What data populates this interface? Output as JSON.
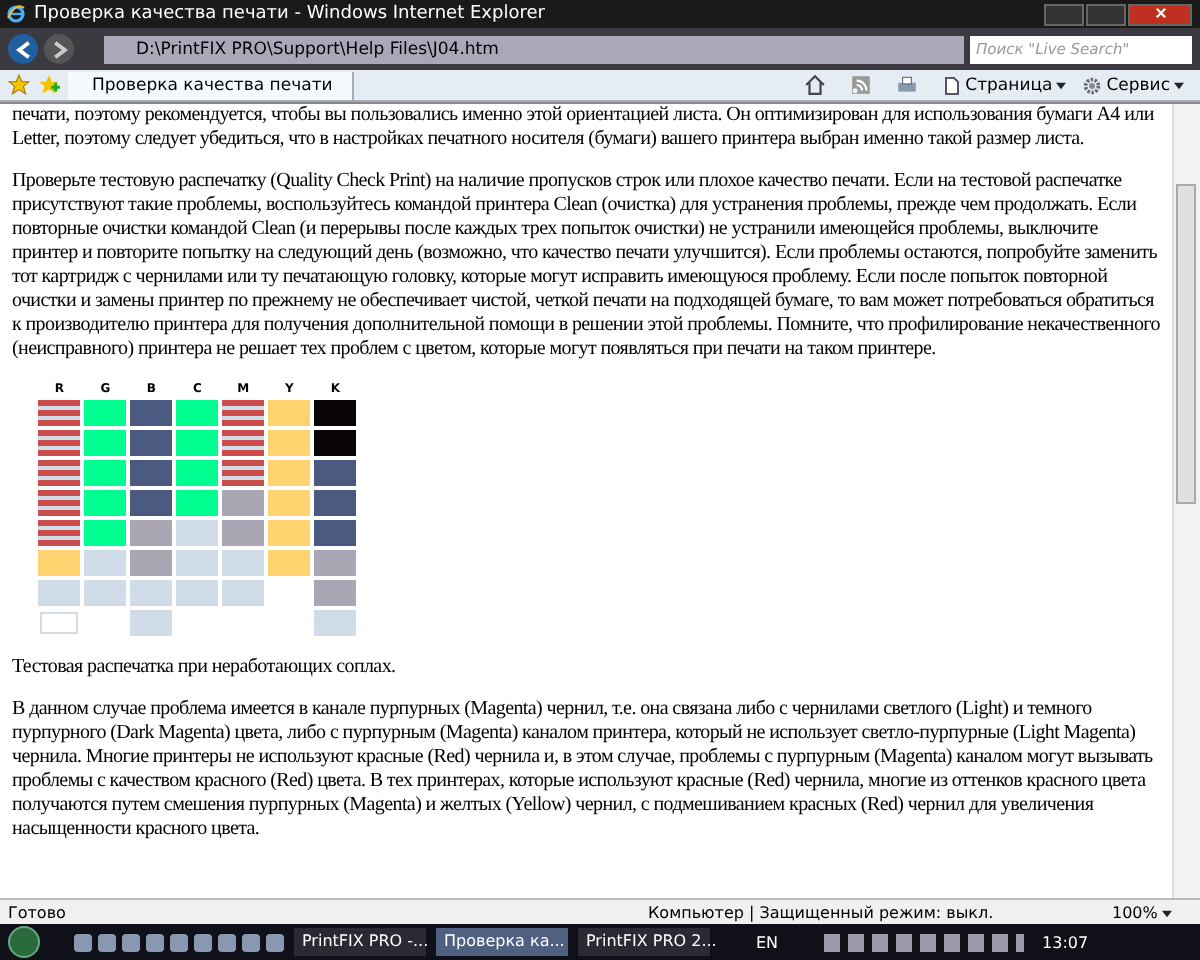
{
  "window": {
    "title": "Проверка качества печати - Windows Internet Explorer"
  },
  "address_bar": {
    "url": "D:\\PrintFIX PRO\\Support\\Help Files\\J04.htm",
    "search_placeholder": "Поиск \"Live Search\""
  },
  "tab": {
    "label": "Проверка качества печати",
    "selected": true
  },
  "tools": [
    {
      "label": "Страница",
      "kind": "page"
    },
    {
      "label": "Сервис",
      "kind": "tools"
    }
  ],
  "content": {
    "paragraphs_top": [
      "печати, поэтому рекомендуется, чтобы вы пользовались именно этой ориентацией листа. Он оптимизирован для использования бумаги A4 или Letter, поэтому следует убедиться, что в настройках печатного носителя (бумаги) вашего принтера выбран именно такой размер листа.",
      "Проверьте тестовую распечатку (Quality Check Print) на наличие пропусков строк или плохое качество печати. Если на тестовой распечатке присутствуют такие проблемы, воспользуйтесь командой принтера Clean (очистка) для устранения проблемы, прежде чем продолжать. Если повторные очистки командой Clean (и перерывы после каждых трех попыток очистки) не устранили имеющейся проблемы, выключите принтер и повторите попытку на следующий день (возможно, что качество печати улучшится). Если проблемы остаются, попробуйте заменить тот картридж с чернилами или ту печатающую головку, которые могут исправить имеющуюся проблему. Если после попыток повторной очистки и замены принтер по прежнему не обеспечивает чистой, четкой печати на подходящей бумаге, то вам может потребоваться обратиться к производителю принтера для получения дополнительной помощи в решении этой проблемы. Помните, что профилирование некачественного (неисправного) принтера не решает тех проблем с цветом, которые могут появляться при печати на таком принтере."
    ],
    "test_print": {
      "columns": [
        {
          "label": "R",
          "color": "#cc4d4d"
        },
        {
          "label": "G",
          "color": "#00ff90"
        },
        {
          "label": "B",
          "color": "#4a5a80"
        },
        {
          "label": "C",
          "color": "#00ff90"
        },
        {
          "label": "M",
          "color": "#cc4d4d"
        },
        {
          "label": "Y",
          "color": "#ffd470"
        },
        {
          "label": "K",
          "color": "#080408"
        }
      ]
    },
    "caption": "Тестовая распечатка при неработающих соплах.",
    "paragraphs_bottom": [
      "В данном случае проблема имеется в канале пурпурных (Magenta) чернил, т.е. она связана либо с чернилами светлого (Light) и темного пурпурного (Dark Magenta) цвета, либо с пурпурным (Magenta) каналом принтера, который не использует светло-пурпурные (Light Magenta) чернила. Многие принтеры не используют красные (Red) чернила и, в этом случае, проблемы с пурпурным (Magenta) каналом могут вызывать проблемы с качеством красного (Red) цвета. В тех принтерах, которые используют красные (Red) чернила, многие из оттенков красного цвета получаются путем смешения пурпурных (Magenta) и желтых (Yellow) чернил, с подмешиванием красных (Red) чернил для увеличения насыщенности красного цвета."
    ]
  },
  "status_bar": {
    "status": "Готово",
    "zone": "Компьютер | Защищенный режим: выкл.",
    "zoom": "100%"
  },
  "taskbar": {
    "tasks": [
      {
        "label": "PrintFIX PRO -...",
        "selected": false
      },
      {
        "label": "Проверка ка...",
        "selected": true
      },
      {
        "label": "PrintFIX PRO 2...",
        "selected": false
      }
    ],
    "language": "EN",
    "clock": "13:07"
  }
}
